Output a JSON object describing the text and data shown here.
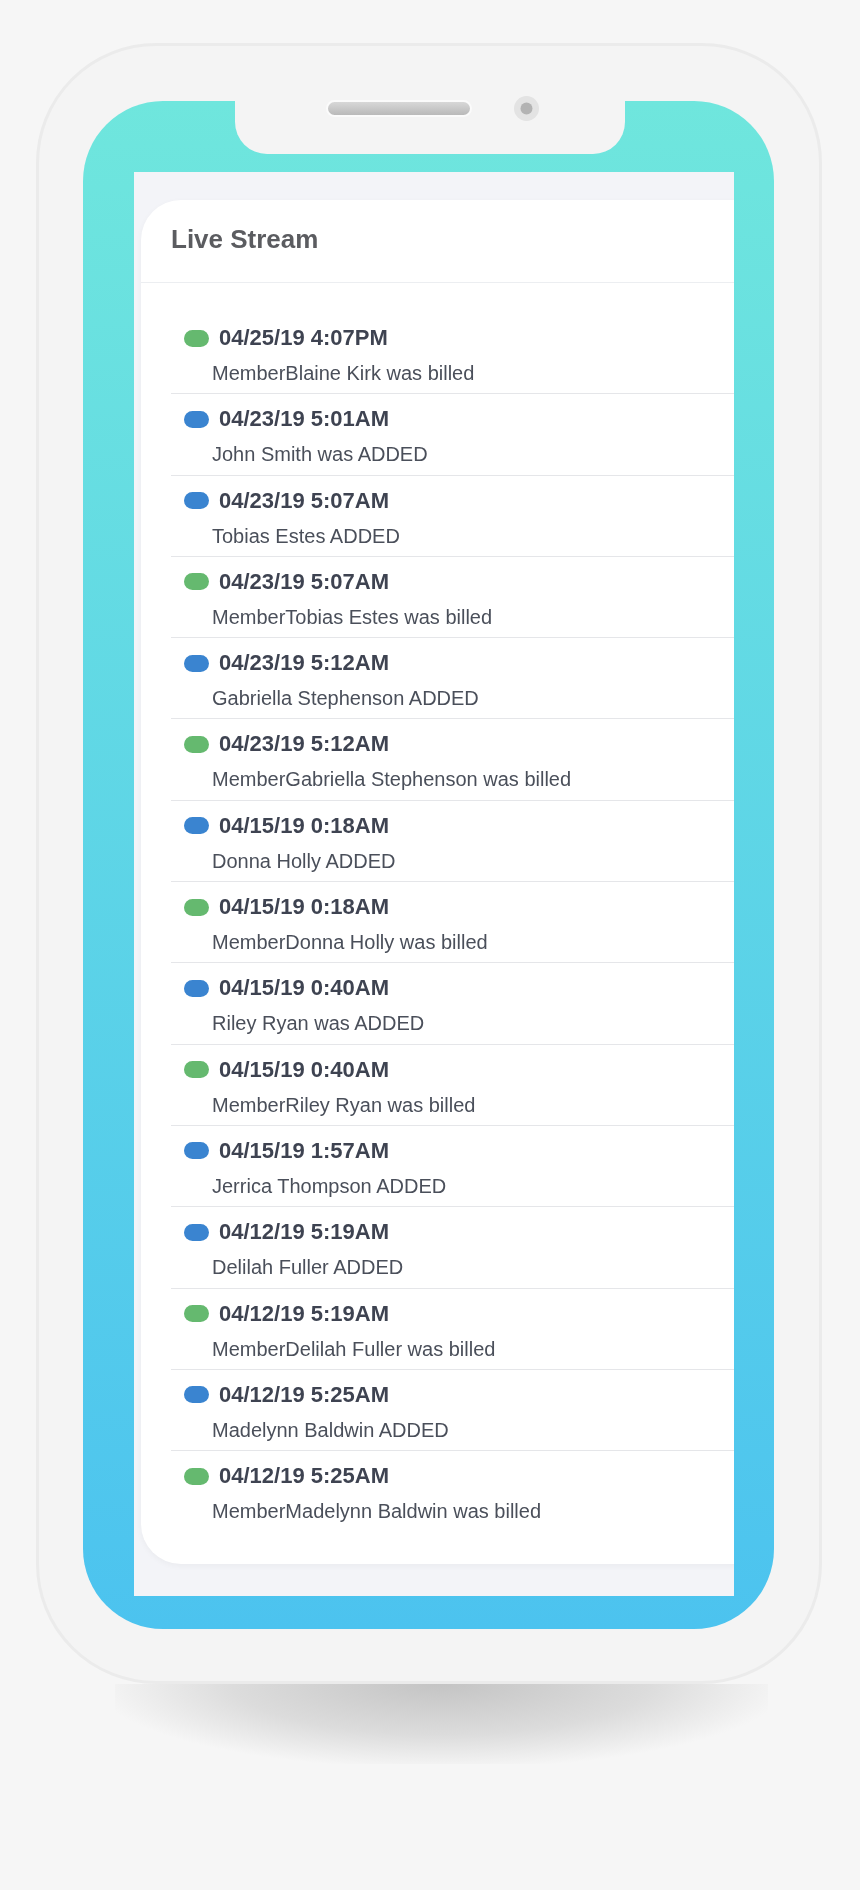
{
  "card": {
    "title": "Live Stream"
  },
  "events": [
    {
      "color": "#65b96f",
      "time": "04/25/19 4:07PM",
      "text": "MemberBlaine Kirk was billed"
    },
    {
      "color": "#3a84d0",
      "time": "04/23/19 5:01AM",
      "text": "John Smith was ADDED"
    },
    {
      "color": "#3a84d0",
      "time": "04/23/19 5:07AM",
      "text": "Tobias Estes ADDED"
    },
    {
      "color": "#65b96f",
      "time": "04/23/19 5:07AM",
      "text": "MemberTobias Estes was billed"
    },
    {
      "color": "#3a84d0",
      "time": "04/23/19 5:12AM",
      "text": "Gabriella Stephenson ADDED"
    },
    {
      "color": "#65b96f",
      "time": "04/23/19 5:12AM",
      "text": "MemberGabriella Stephenson was billed"
    },
    {
      "color": "#3a84d0",
      "time": "04/15/19 0:18AM",
      "text": "Donna Holly ADDED"
    },
    {
      "color": "#65b96f",
      "time": "04/15/19 0:18AM",
      "text": "MemberDonna Holly was billed"
    },
    {
      "color": "#3a84d0",
      "time": "04/15/19 0:40AM",
      "text": "Riley Ryan was ADDED"
    },
    {
      "color": "#65b96f",
      "time": "04/15/19 0:40AM",
      "text": "MemberRiley Ryan was billed"
    },
    {
      "color": "#3a84d0",
      "time": "04/15/19 1:57AM",
      "text": "Jerrica Thompson ADDED"
    },
    {
      "color": "#3a84d0",
      "time": "04/12/19 5:19AM",
      "text": "Delilah Fuller ADDED"
    },
    {
      "color": "#65b96f",
      "time": "04/12/19 5:19AM",
      "text": "MemberDelilah Fuller was billed"
    },
    {
      "color": "#3a84d0",
      "time": "04/12/19 5:25AM",
      "text": "Madelynn Baldwin ADDED"
    },
    {
      "color": "#65b96f",
      "time": "04/12/19 5:25AM",
      "text": "MemberMadelynn Baldwin was billed"
    }
  ]
}
